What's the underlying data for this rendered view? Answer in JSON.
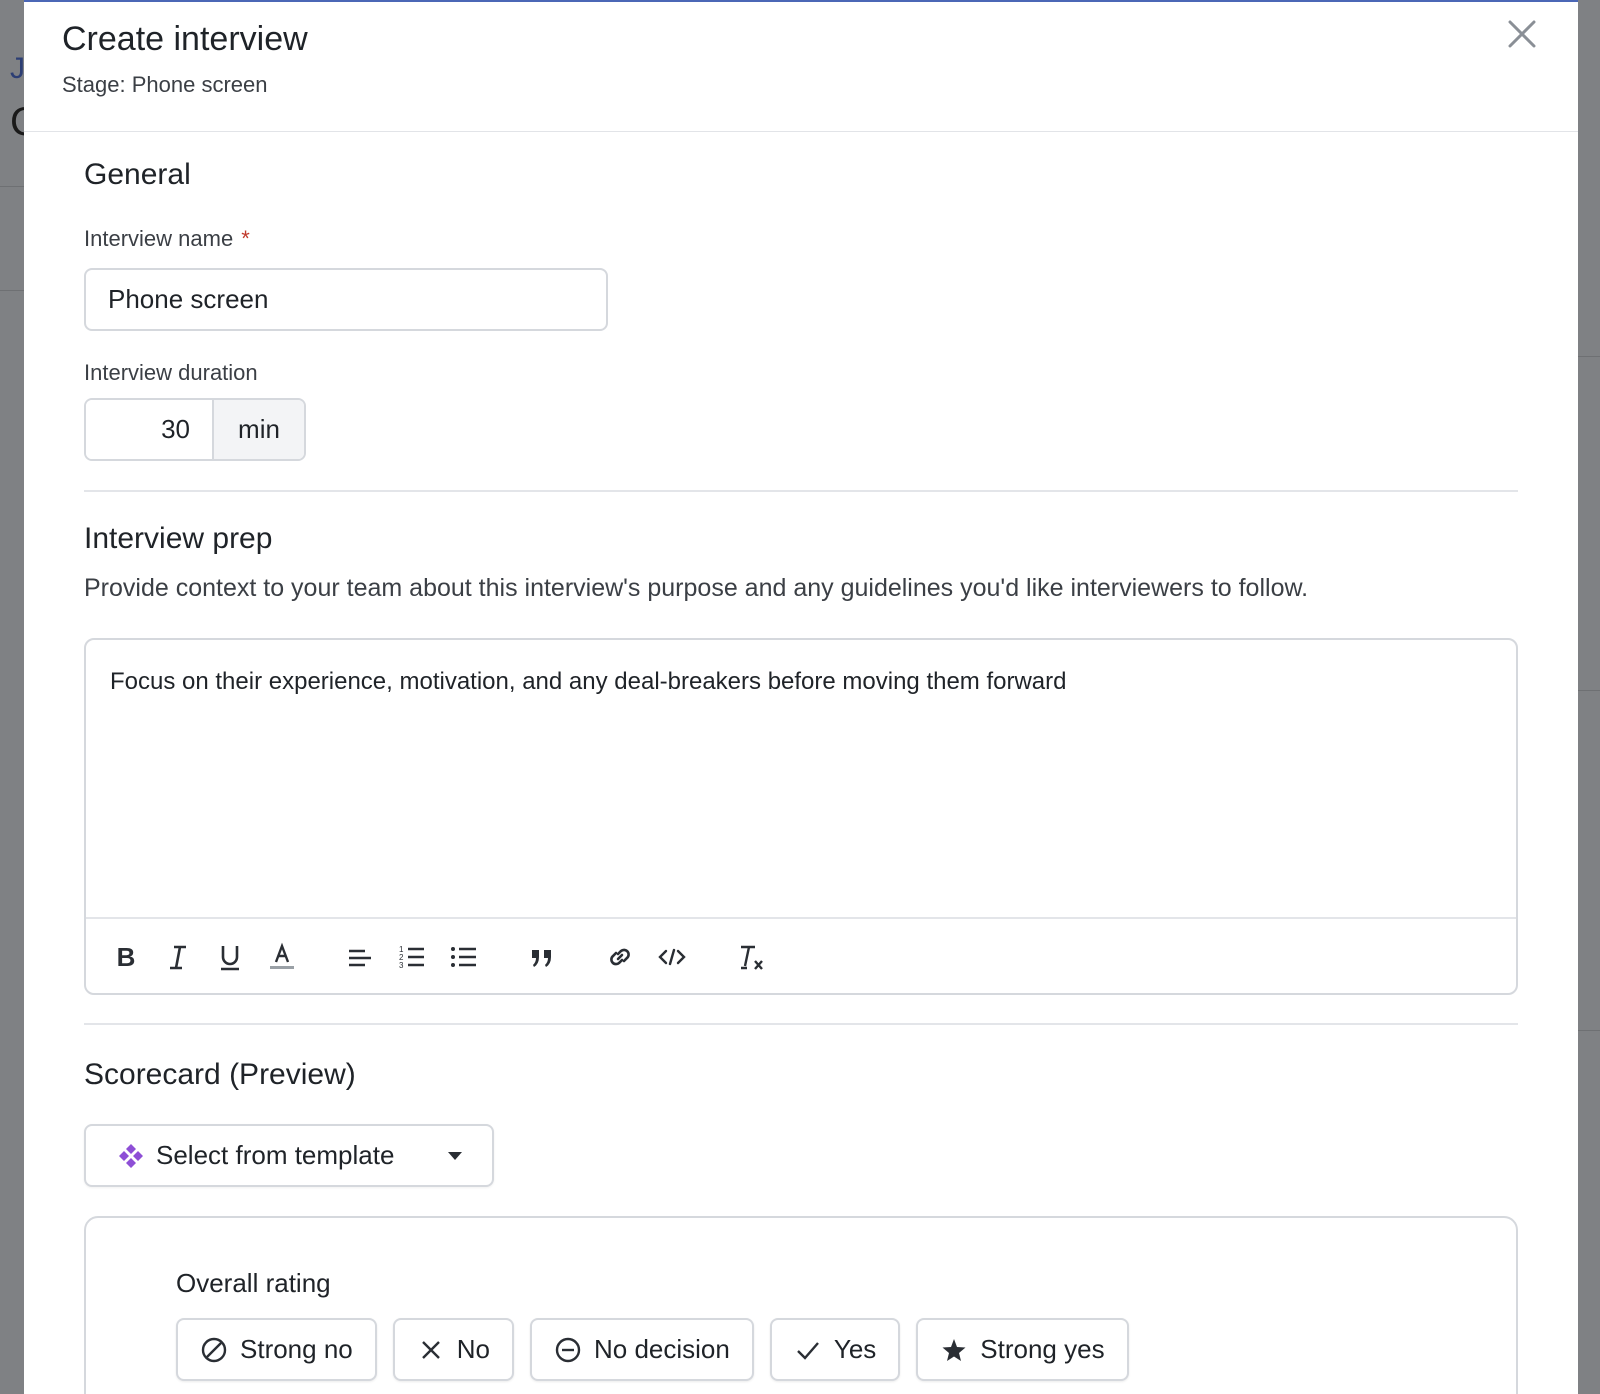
{
  "modal": {
    "title": "Create interview",
    "subtitle": "Stage: Phone screen"
  },
  "general": {
    "section_title": "General",
    "name_label": "Interview name",
    "required_mark": "*",
    "name_value": "Phone screen",
    "duration_label": "Interview duration",
    "duration_value": "30",
    "duration_unit": "min"
  },
  "prep": {
    "section_title": "Interview prep",
    "description": "Provide context to your team about this interview's purpose and any guidelines you'd like interviewers to follow.",
    "editor_text": "Focus on their experience, motivation, and any deal-breakers before moving them forward",
    "toolbar": [
      "bold-icon",
      "italic-icon",
      "underline-icon",
      "text-color-icon",
      "align-left-icon",
      "ordered-list-icon",
      "bullet-list-icon",
      "blockquote-icon",
      "link-icon",
      "code-icon",
      "clear-format-icon"
    ]
  },
  "scorecard": {
    "section_title": "Scorecard (Preview)",
    "template_button": "Select from template",
    "template_icon_color": "#8e4fd6",
    "rating_label": "Overall rating",
    "ratings": [
      {
        "label": "Strong no",
        "icon": "ban-icon"
      },
      {
        "label": "No",
        "icon": "x-icon"
      },
      {
        "label": "No decision",
        "icon": "minus-circle-icon"
      },
      {
        "label": "Yes",
        "icon": "check-icon"
      },
      {
        "label": "Strong yes",
        "icon": "star-icon"
      }
    ]
  },
  "background": {
    "glyph_1": "J",
    "glyph_2": "C"
  },
  "colors": {
    "accent": "#4b67b6",
    "required": "#c0392b",
    "border": "#d5d8dd"
  }
}
